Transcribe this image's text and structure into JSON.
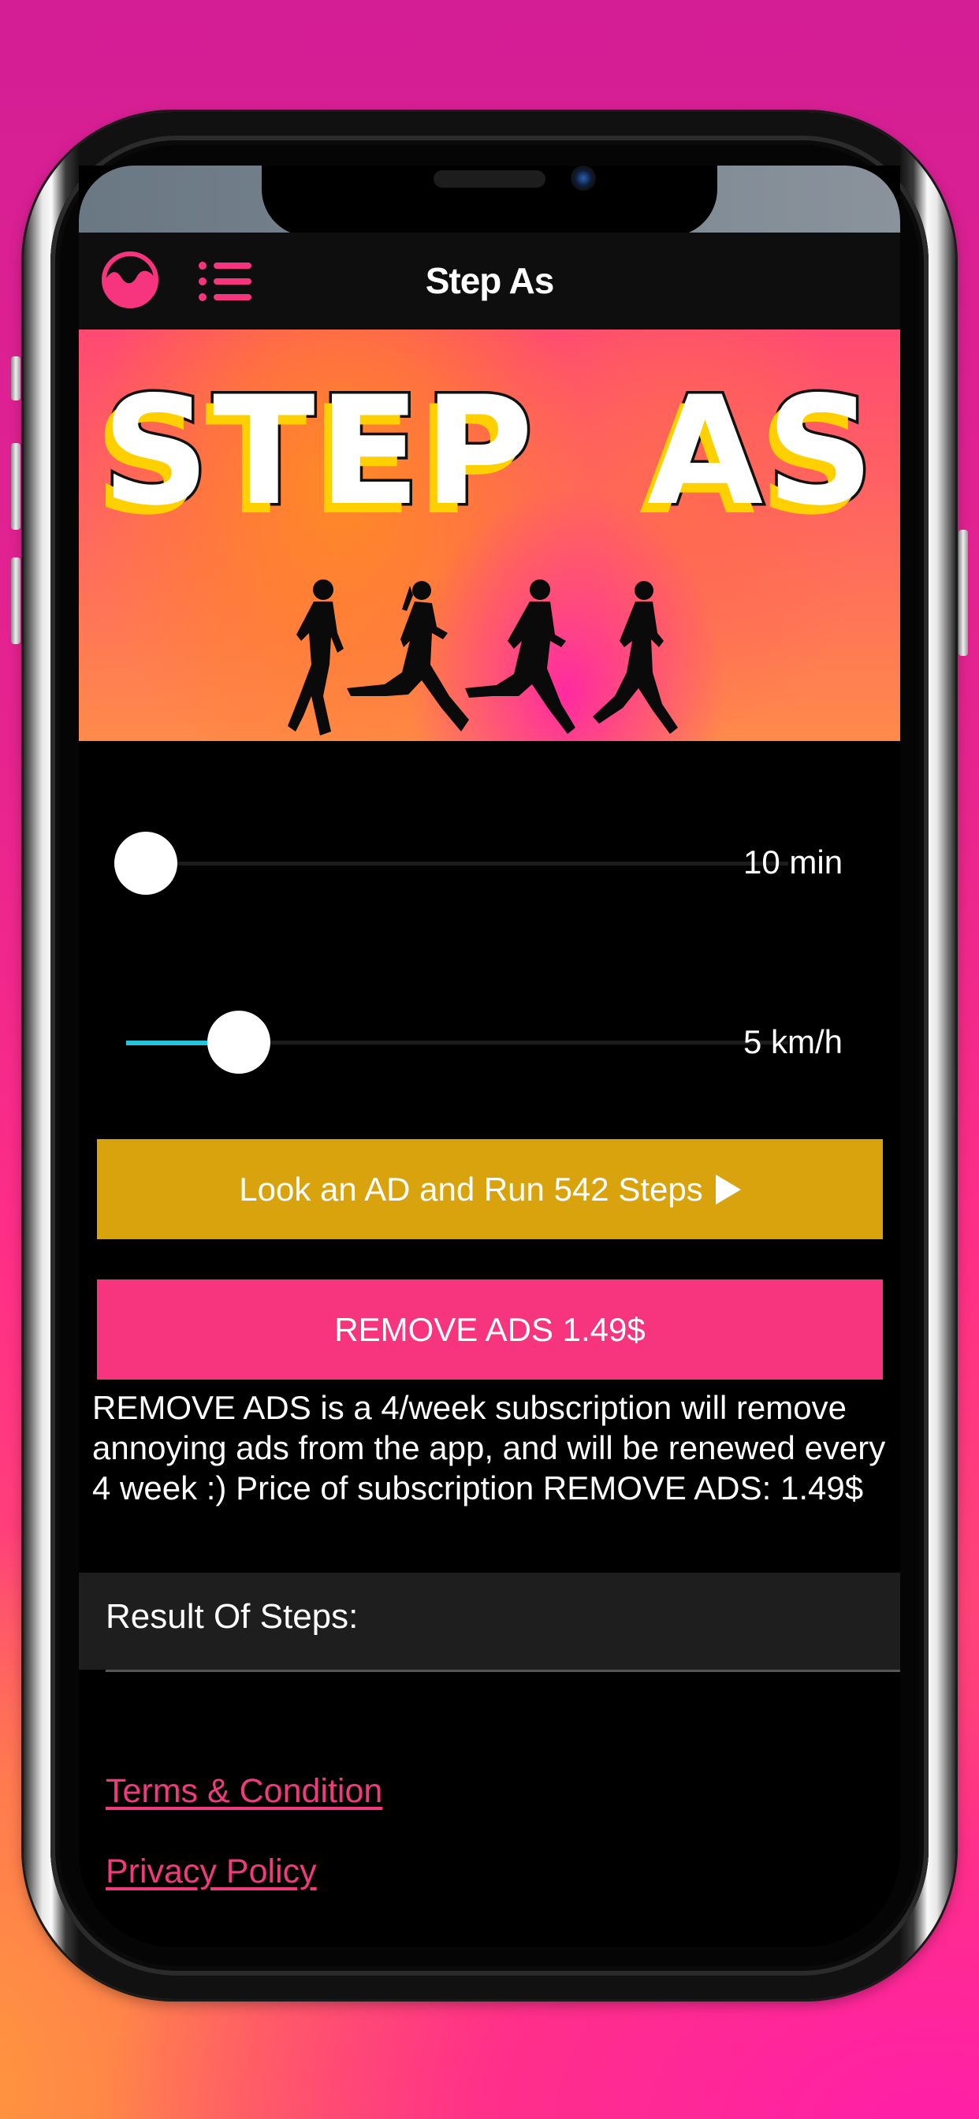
{
  "app": {
    "title": "Step As",
    "logo_icon": "wave-circle-logo-icon",
    "menu_icon": "list-menu-icon",
    "accent_color": "#f7347e"
  },
  "banner": {
    "title": "STEP  AS",
    "image_subject": "four-running-silhouettes"
  },
  "sliders": [
    {
      "name": "duration",
      "value_label": "10 min",
      "fraction": 0.03,
      "fill_color": "#22c4de"
    },
    {
      "name": "speed",
      "value_label": "5 km/h",
      "fraction": 0.17,
      "fill_color": "#22c4de"
    }
  ],
  "buttons": {
    "watch_ad": {
      "label": "Look an AD and Run 542 Steps",
      "icon": "play-icon",
      "color": "#d9a30e"
    },
    "remove_ads": {
      "label": "REMOVE ADS 1.49$",
      "color": "#f7347e"
    }
  },
  "description": "REMOVE ADS is a 4/week subscription will remove annoying ads from the app, and will be renewed every 4 week :) Price of subscription REMOVE ADS: 1.49$",
  "result": {
    "label": "Result Of Steps:",
    "value": ""
  },
  "links": {
    "terms": "Terms & Condition",
    "privacy": "Privacy Policy"
  }
}
